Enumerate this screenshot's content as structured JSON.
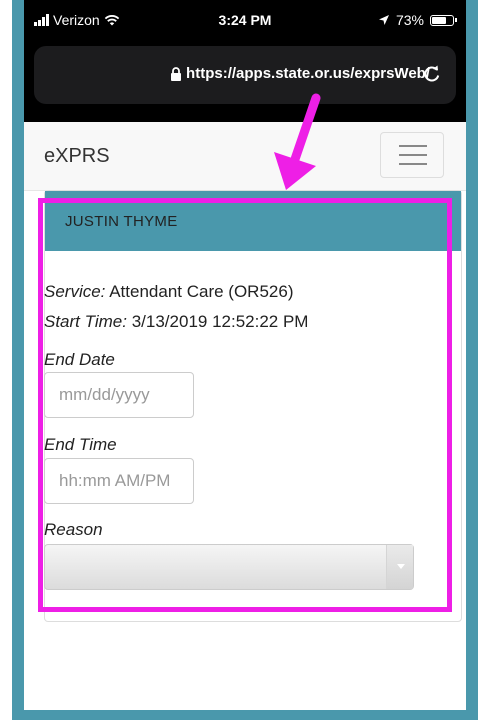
{
  "status_bar": {
    "carrier": "Verizon",
    "time": "3:24 PM",
    "battery_percent": "73%",
    "battery_level": 0.73
  },
  "browser": {
    "url": "https://apps.state.or.us/exprsWeb/"
  },
  "navbar": {
    "brand": "eXPRS"
  },
  "panel": {
    "heading": "JUSTIN THYME",
    "service_label": "Service:",
    "service_value": "Attendant Care (OR526)",
    "start_time_label": "Start Time:",
    "start_time_value": "3/13/2019 12:52:22 PM",
    "end_date_label": "End Date",
    "end_date_placeholder": "mm/dd/yyyy",
    "end_time_label": "End Time",
    "end_time_placeholder": "hh:mm AM/PM",
    "reason_label": "Reason",
    "reason_value": ""
  },
  "colors": {
    "frame": "#4a98ac",
    "panel_heading": "#4a98ac",
    "annotation": "#ee1fe6"
  }
}
